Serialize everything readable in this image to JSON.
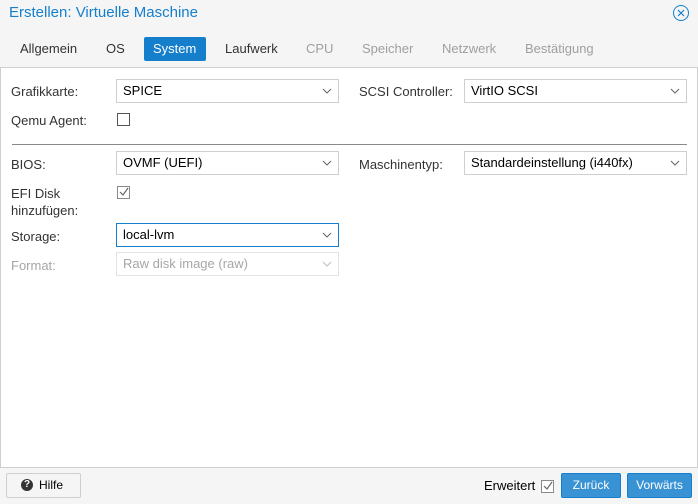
{
  "window": {
    "title": "Erstellen: Virtuelle Maschine",
    "close_icon": "close-circle-icon",
    "accent_color": "#157fcc"
  },
  "tabs": [
    {
      "label": "Allgemein",
      "state": "normal"
    },
    {
      "label": "OS",
      "state": "normal"
    },
    {
      "label": "System",
      "state": "active"
    },
    {
      "label": "Laufwerk",
      "state": "normal"
    },
    {
      "label": "CPU",
      "state": "disabled"
    },
    {
      "label": "Speicher",
      "state": "disabled"
    },
    {
      "label": "Netzwerk",
      "state": "disabled"
    },
    {
      "label": "Bestätigung",
      "state": "disabled"
    }
  ],
  "form": {
    "graphics_label": "Grafikkarte:",
    "graphics_value": "SPICE",
    "scsi_label": "SCSI Controller:",
    "scsi_value": "VirtIO SCSI",
    "qemu_agent_label": "Qemu Agent:",
    "qemu_agent_checked": false,
    "bios_label": "BIOS:",
    "bios_value": "OVMF (UEFI)",
    "machine_label": "Maschinentyp:",
    "machine_value": "Standardeinstellung (i440fx)",
    "efi_label_line1": "EFI Disk",
    "efi_label_line2": "hinzufügen:",
    "efi_checked": true,
    "storage_label": "Storage:",
    "storage_value": "local-lvm",
    "format_label": "Format:",
    "format_value": "Raw disk image (raw)"
  },
  "footer": {
    "help_label": "Hilfe",
    "help_icon": "question-circle-icon",
    "advanced_label": "Erweitert",
    "advanced_checked": true,
    "back_label": "Zurück",
    "next_label": "Vorwärts"
  }
}
